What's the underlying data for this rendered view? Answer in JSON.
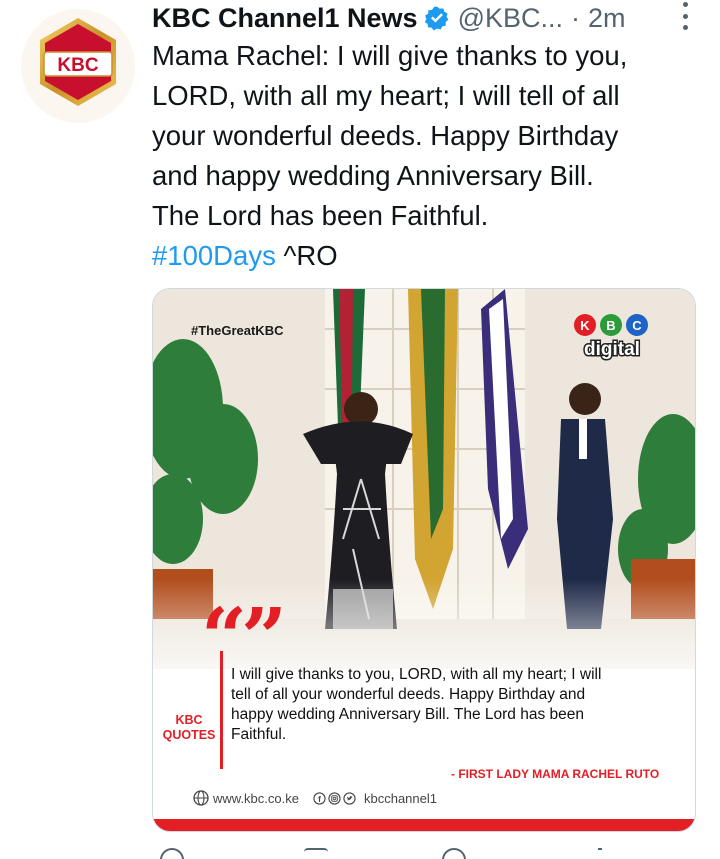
{
  "author": {
    "display_name": "KBC Channel1 News",
    "handle": "@KBC...",
    "separator": "·",
    "time": "2m",
    "avatar_text": "KBC"
  },
  "tweet": {
    "lines": [
      "Mama Rachel: I will give thanks to you,",
      "LORD, with all my heart; I will tell of all",
      "your wonderful deeds. Happy Birthday",
      "and happy wedding Anniversary  Bill.",
      "The Lord has been Faithful."
    ],
    "hashtag": "#100Days",
    "suffix": " ^RO"
  },
  "media": {
    "tag": "#TheGreatKBC",
    "brand_letters": [
      "K",
      "B",
      "C"
    ],
    "brand_word": "digital",
    "quote_marks": "“”",
    "side_label_1": "KBC",
    "side_label_2": "QUOTES",
    "quote_lines": [
      "I will give thanks to you, LORD, with all my heart; I will",
      "tell of all your wonderful deeds. Happy Birthday and",
      "happy wedding Anniversary  Bill. The Lord has been",
      "Faithful."
    ],
    "attribution": "- FIRST LADY MAMA RACHEL RUTO",
    "website": "www.kbc.co.ke",
    "social_handle": "kbcchannel1"
  },
  "colors": {
    "accent_red": "#e31e24",
    "link_blue": "#1d9bf0",
    "text": "#0f1419",
    "muted": "#536471"
  }
}
